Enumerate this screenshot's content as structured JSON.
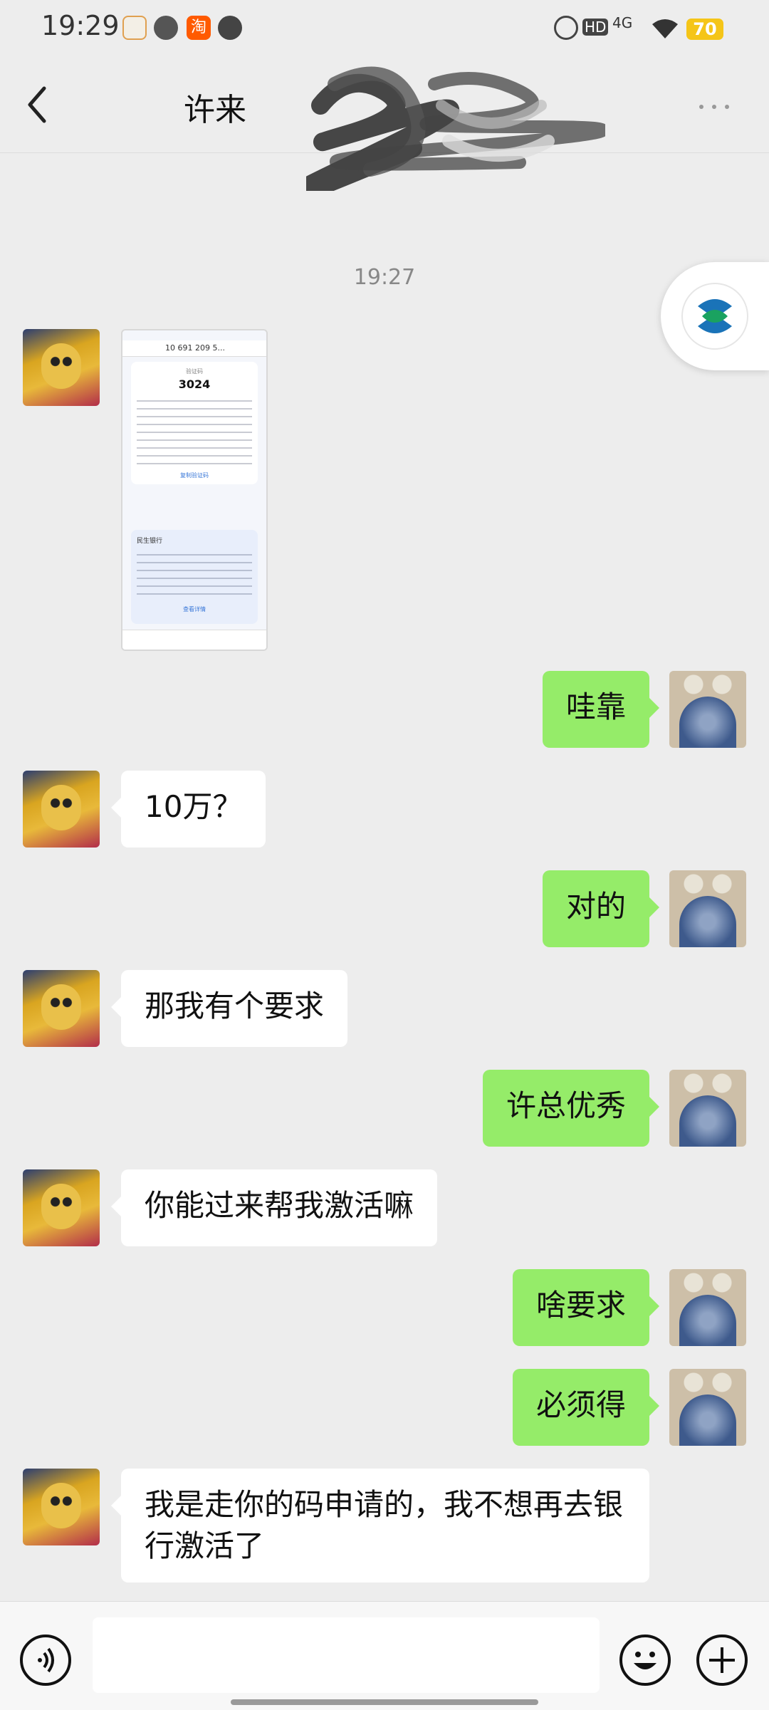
{
  "status_bar": {
    "time": "19:29",
    "network": "4G",
    "hd": "HD",
    "battery": "70",
    "app_icons": [
      "weibo-icon",
      "fan-icon",
      "taobao-icon",
      "compass-icon"
    ]
  },
  "header": {
    "title": "许来"
  },
  "chat": {
    "timestamp": "19:27",
    "image_message": {
      "sender_number": "10 691 209 5...",
      "code_label": "验证码",
      "code": "3024",
      "link_1": "复制验证码",
      "card2_title": "民生银行",
      "link_2": "查看详情"
    },
    "messages": [
      {
        "side": "right",
        "text": "哇靠"
      },
      {
        "side": "left",
        "text": "10万？"
      },
      {
        "side": "right",
        "text": "对的"
      },
      {
        "side": "left",
        "text": "那我有个要求"
      },
      {
        "side": "right",
        "text": "许总优秀"
      },
      {
        "side": "left",
        "text": "你能过来帮我激活嘛"
      },
      {
        "side": "right",
        "text": "啥要求"
      },
      {
        "side": "right",
        "text": "必须得"
      },
      {
        "side": "left",
        "text": "我是走你的码申请的，我不想再去银行激活了"
      }
    ]
  },
  "input_bar": {
    "value": "",
    "icons": [
      "voice-icon",
      "emoji-icon",
      "plus-icon"
    ]
  },
  "colors": {
    "background": "#ededed",
    "sent_bubble": "#95ec69",
    "received_bubble": "#ffffff",
    "battery": "#f5c518"
  }
}
